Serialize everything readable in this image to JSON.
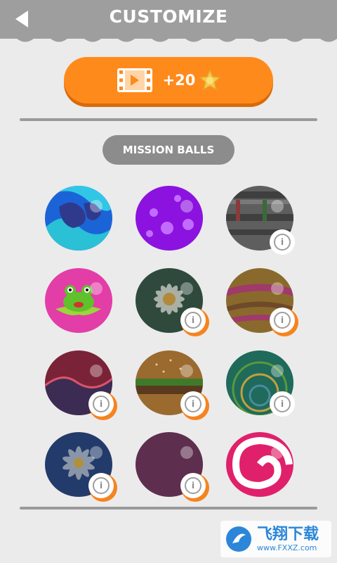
{
  "header": {
    "title": "CUSTOMIZE"
  },
  "reward_button": {
    "label": "+20"
  },
  "section": {
    "label": "MISSION BALLS"
  },
  "balls": [
    {
      "name": "blue-swirl-ball",
      "locked": false
    },
    {
      "name": "purple-spotted-ball",
      "locked": false
    },
    {
      "name": "grey-striped-ball",
      "locked": true,
      "lock_style": "white"
    },
    {
      "name": "frog-ball",
      "locked": false
    },
    {
      "name": "daisy-ball",
      "locked": true,
      "lock_style": "orange"
    },
    {
      "name": "olive-striped-ball",
      "locked": true,
      "lock_style": "orange"
    },
    {
      "name": "maroon-wave-ball",
      "locked": true,
      "lock_style": "orange"
    },
    {
      "name": "burger-ball",
      "locked": true,
      "lock_style": "orange"
    },
    {
      "name": "green-lines-ball",
      "locked": true,
      "lock_style": "white"
    },
    {
      "name": "navy-flower-ball",
      "locked": true,
      "lock_style": "orange"
    },
    {
      "name": "plum-ball",
      "locked": true,
      "lock_style": "orange"
    },
    {
      "name": "candy-swirl-ball",
      "locked": false
    }
  ],
  "lock_icon_glyph": "i",
  "watermark": {
    "cn": "飞翔下载",
    "url": "www.FXXZ.com"
  },
  "colors": {
    "accent": "#ff8a1c",
    "header": "#9e9e9e",
    "background": "#ebebeb",
    "lock_ring": "#f5841f"
  }
}
